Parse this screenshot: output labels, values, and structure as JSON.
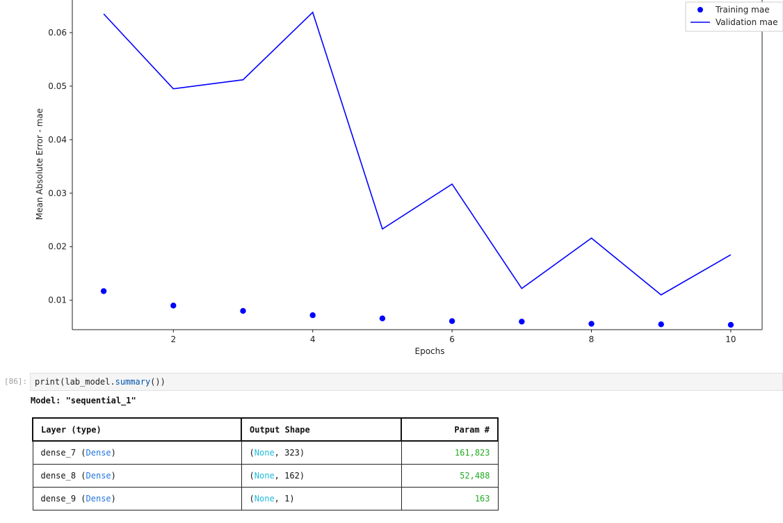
{
  "chart_data": {
    "type": "line",
    "title": "",
    "xlabel": "Epochs",
    "ylabel": "Mean Absolute Error - mae",
    "x": [
      1,
      2,
      3,
      4,
      5,
      6,
      7,
      8,
      9,
      10
    ],
    "xlim": [
      0.55,
      10.45
    ],
    "ylim": [
      0.0045,
      0.0661
    ],
    "xticks": [
      2,
      4,
      6,
      8,
      10
    ],
    "yticks": [
      0.01,
      0.02,
      0.03,
      0.04,
      0.05,
      0.06
    ],
    "ytick_labels": [
      "0.01",
      "0.02",
      "0.03",
      "0.04",
      "0.05",
      "0.06"
    ],
    "grid": false,
    "legend_position": "top-right",
    "series": [
      {
        "name": "Training mae",
        "style": "markers",
        "color": "#0000ff",
        "values": [
          0.0117,
          0.009,
          0.008,
          0.0072,
          0.0066,
          0.0061,
          0.006,
          0.0056,
          0.0055,
          0.0054
        ]
      },
      {
        "name": "Validation mae",
        "style": "line",
        "color": "#0000ff",
        "values": [
          0.0635,
          0.0495,
          0.0512,
          0.0638,
          0.0233,
          0.0317,
          0.0122,
          0.0216,
          0.011,
          0.0185
        ]
      }
    ]
  },
  "cell": {
    "prompt": "[86]:",
    "code_prefix": "print(lab_model.",
    "code_method": "summary",
    "code_suffix": "())"
  },
  "model_title": "Model: \"sequential_1\"",
  "summary": {
    "headers": {
      "layer": "Layer (type)",
      "shape": "Output Shape",
      "params": "Param #"
    },
    "rows": [
      {
        "name": "dense_7",
        "type": "Dense",
        "dim": "323",
        "params": "161,823"
      },
      {
        "name": "dense_8",
        "type": "Dense",
        "dim": "162",
        "params": "52,488"
      },
      {
        "name": "dense_9",
        "type": "Dense",
        "dim": "1",
        "params": "163"
      }
    ],
    "none_label": "None"
  },
  "colors": {
    "series": "#0000ff",
    "type_text": "#2277dd",
    "none_text": "#22bbdd",
    "params_text": "#22aa22"
  }
}
